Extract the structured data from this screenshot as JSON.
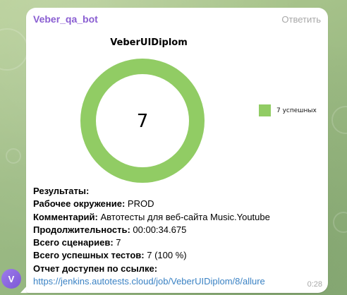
{
  "chat": {
    "avatar_letter": "V"
  },
  "message": {
    "sender": "Veber_qa_bot",
    "reply_label": "Ответить",
    "time": "0:28",
    "lines": [
      {
        "label": "Результаты:",
        "value": ""
      },
      {
        "label": "Рабочее окружение:",
        "value": " PROD"
      },
      {
        "label": "Комментарий:",
        "value": " Автотесты для веб-сайта Music.Youtube"
      },
      {
        "label": "Продолжительность:",
        "value": " 00:00:34.675"
      },
      {
        "label": "Всего сценариев:",
        "value": " 7"
      },
      {
        "label": "Всего успешных тестов:",
        "value": " 7 (100 %)"
      },
      {
        "label": "Отчет доступен по ссылке:",
        "value": ""
      }
    ],
    "link": "https://jenkins.autotests.cloud/job/VeberUIDiplom/8/allure"
  },
  "chart_data": {
    "type": "pie",
    "title": "VeberUIDiplom",
    "center_label": "7",
    "series": [
      {
        "name": "7 успешных",
        "value": 7,
        "color": "#91cc64"
      }
    ],
    "legend": "right",
    "donut": true
  }
}
